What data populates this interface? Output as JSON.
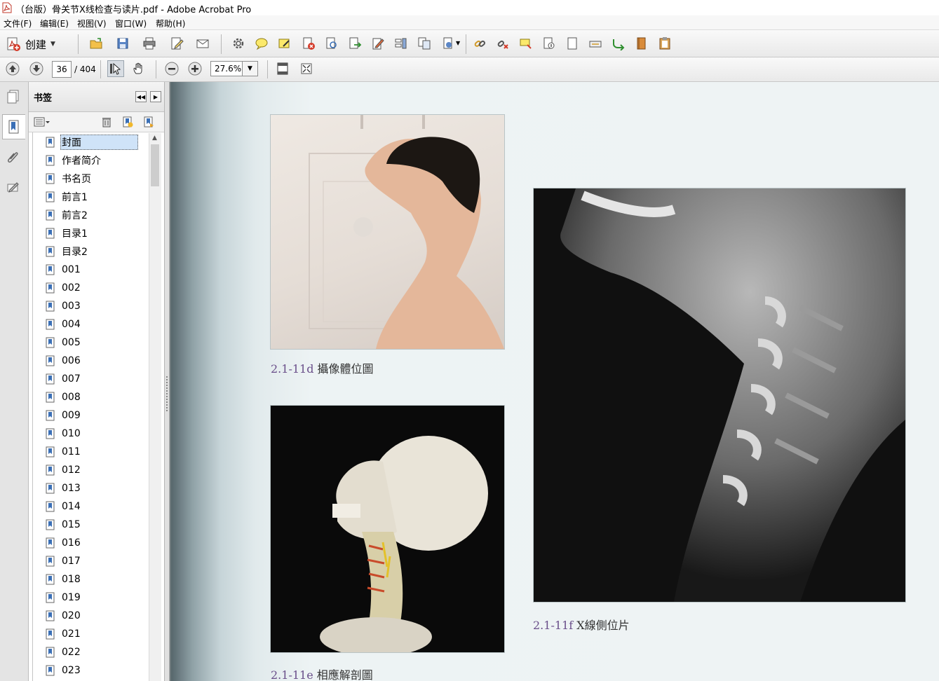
{
  "window": {
    "title": "（台版）骨关节X线检查与读片.pdf - Adobe Acrobat Pro"
  },
  "menu": [
    "文件(F)",
    "编辑(E)",
    "视图(V)",
    "窗口(W)",
    "帮助(H)"
  ],
  "toolbar": {
    "create_label": "创建"
  },
  "nav": {
    "current_page": "36",
    "total_pages": "/ 404",
    "zoom": "27.6%"
  },
  "bookmarks": {
    "title": "书签",
    "items": [
      "封面",
      "作者简介",
      "书名页",
      "前言1",
      "前言2",
      "目录1",
      "目录2",
      "001",
      "002",
      "003",
      "004",
      "005",
      "006",
      "007",
      "008",
      "009",
      "010",
      "011",
      "012",
      "013",
      "014",
      "015",
      "016",
      "017",
      "018",
      "019",
      "020",
      "021",
      "022",
      "023"
    ],
    "selected_index": 0
  },
  "document": {
    "captions": {
      "photo_d": {
        "num": "2.1-11d",
        "text": "攝像體位圖"
      },
      "photo_e": {
        "num": "2.1-11e",
        "text": "相應解剖圖"
      },
      "photo_f": {
        "num": "2.1-11f",
        "text": "X線側位片"
      }
    }
  }
}
